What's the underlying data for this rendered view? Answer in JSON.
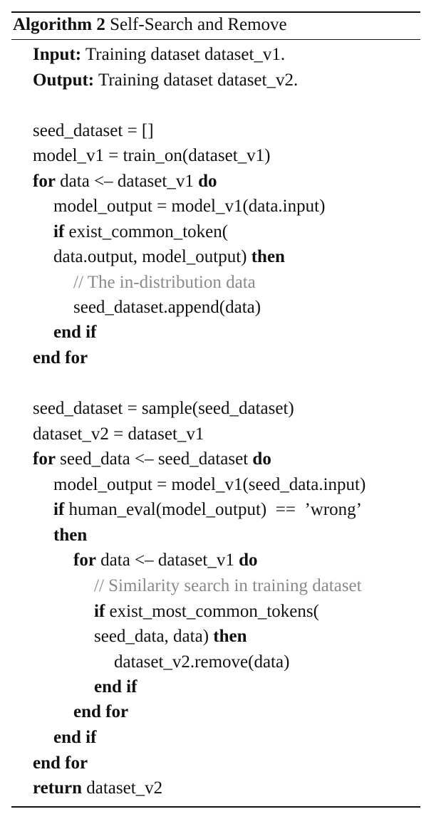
{
  "algorithm": {
    "label": "Algorithm 2",
    "name": "Self-Search and Remove"
  },
  "header": {
    "input_kw": "Input:",
    "input_text": "Training dataset dataset_v1.",
    "output_kw": "Output:",
    "output_text": "Training dataset dataset_v2."
  },
  "code": {
    "l1": "seed_dataset = []",
    "l2": "model_v1 = train_on(dataset_v1)",
    "l3_kw1": "for",
    "l3_text": "data <– dataset_v1",
    "l3_kw2": "do",
    "l4": "model_output = model_v1(data.input)",
    "l5_kw": "if",
    "l5_text": "exist_common_token(",
    "l6_text": "data.output, model_output)",
    "l6_kw": "then",
    "l7_comment": "// The in-distribution data",
    "l8": "seed_dataset.append(data)",
    "l9": "end if",
    "l10": "end for",
    "l11": "seed_dataset = sample(seed_dataset)",
    "l12": "dataset_v2 = dataset_v1",
    "l13_kw1": "for",
    "l13_text": "seed_data <– seed_dataset",
    "l13_kw2": "do",
    "l14": "model_output = model_v1(seed_data.input)",
    "l15_kw": "if",
    "l15_text": "human_eval(model_output)  ==  ’wrong’",
    "l16": "then",
    "l17_kw1": "for",
    "l17_text": "data <– dataset_v1",
    "l17_kw2": "do",
    "l18_comment": "// Similarity search in training dataset",
    "l19_kw": "if",
    "l19_text": "exist_most_common_tokens(",
    "l20_text": "seed_data, data)",
    "l20_kw": "then",
    "l21": "dataset_v2.remove(data)",
    "l22": "end if",
    "l23": "end for",
    "l24": "end if",
    "l25": "end for",
    "l26_kw": "return",
    "l26_text": "dataset_v2"
  }
}
